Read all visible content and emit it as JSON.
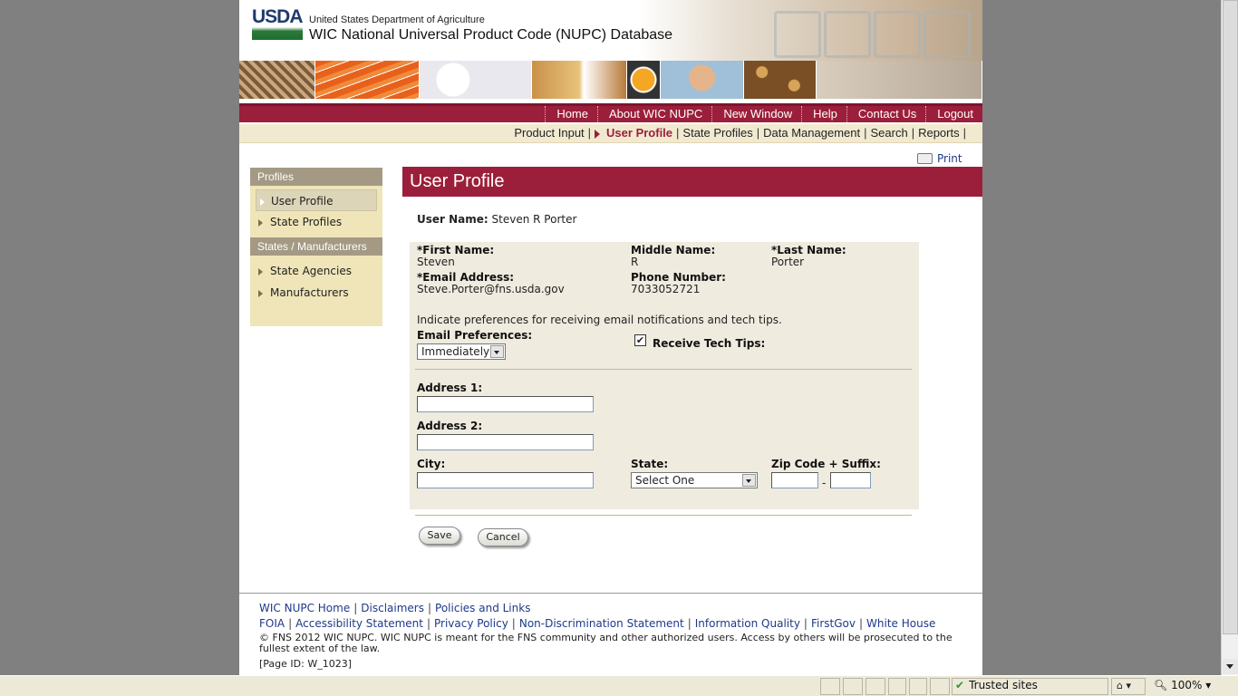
{
  "header": {
    "logo_text": "USDA",
    "department": "United States Department of Agriculture",
    "database_title": "WIC National Universal Product Code (NUPC) Database"
  },
  "main_nav": [
    {
      "label": "Home"
    },
    {
      "label": "About  WIC NUPC"
    },
    {
      "label": "New Window"
    },
    {
      "label": "Help"
    },
    {
      "label": "Contact Us"
    },
    {
      "label": "Logout"
    }
  ],
  "sub_nav": [
    {
      "label": "Product Input",
      "active": false
    },
    {
      "label": "User Profile",
      "active": true
    },
    {
      "label": "State Profiles",
      "active": false
    },
    {
      "label": "Data Management",
      "active": false
    },
    {
      "label": "Search",
      "active": false
    },
    {
      "label": "Reports",
      "active": false
    }
  ],
  "sidebar": {
    "section1_title": "Profiles",
    "section1_items": [
      {
        "label": "User Profile",
        "selected": true
      },
      {
        "label": "State Profiles",
        "selected": false
      }
    ],
    "section2_title": "States / Manufacturers",
    "section2_items": [
      {
        "label": "State Agencies"
      },
      {
        "label": "Manufacturers"
      }
    ]
  },
  "print_label": "Print",
  "page_title": "User Profile",
  "user": {
    "user_name_label": "User Name:",
    "user_name_value": "Steven R Porter"
  },
  "form": {
    "first_name_label": "*First Name:",
    "first_name": "Steven",
    "middle_name_label": "Middle Name:",
    "middle_name": "R",
    "last_name_label": "*Last Name:",
    "last_name": "Porter",
    "email_label": "*Email Address:",
    "email": "Steve.Porter@fns.usda.gov",
    "phone_label": "Phone Number:",
    "phone": "7033052721",
    "pref_note": "Indicate preferences for receiving email notifications and tech tips.",
    "email_pref_label": "Email Preferences:",
    "email_pref_value": "Immediately",
    "tech_tips_label": "Receive Tech Tips:",
    "tech_tips_checked": true,
    "address1_label": "Address 1:",
    "address2_label": "Address 2:",
    "city_label": "City:",
    "state_label": "State:",
    "state_value": "Select One",
    "zip_label": "Zip Code + Suffix:",
    "zip_dash": "-",
    "save_label": "Save",
    "cancel_label": "Cancel"
  },
  "footer": {
    "row1": [
      "WIC NUPC Home",
      "Disclaimers",
      "Policies and Links"
    ],
    "row2": [
      "FOIA",
      "Accessibility Statement",
      "Privacy Policy",
      "Non-Discrimination Statement",
      "Information Quality",
      "FirstGov",
      "White House"
    ],
    "copyright": "© FNS 2012 WIC NUPC. WIC NUPC is meant for the FNS community and other authorized users. Access by others will be prosecuted to the fullest extent of the law.",
    "page_id": "[Page ID: W_1023]"
  },
  "statusbar": {
    "zone": "Trusted sites",
    "zoom": "100%"
  },
  "colors": {
    "brand_maroon": "#9b1f3a",
    "subnav_bg": "#f1ead0",
    "sidebar_bg": "#efe5b8",
    "form_bg": "#efebdf",
    "link": "#1d3a8a"
  }
}
